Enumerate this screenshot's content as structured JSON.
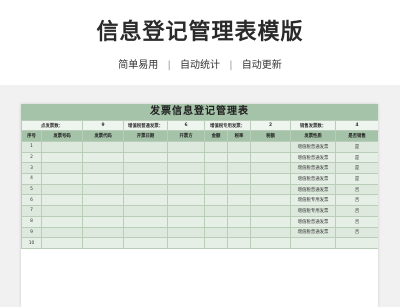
{
  "page": {
    "title": "信息登记管理表模版",
    "features": [
      "简单易用",
      "自动统计",
      "自动更新"
    ],
    "separator": "|"
  },
  "sheet": {
    "title": "发票信息登记管理表",
    "summary": [
      {
        "label": "点发票数：",
        "value": "9"
      },
      {
        "label": "增值税普通发票：",
        "value": "6"
      },
      {
        "label": "增值税专用发票：",
        "value": "2"
      },
      {
        "label": "销售发票数：",
        "value": "4"
      }
    ],
    "columns": [
      "序号",
      "发票号码",
      "发票代码",
      "开票日期",
      "开票方",
      "金额",
      "税率",
      "税额",
      "发票性质",
      "是否销售"
    ],
    "rows": [
      {
        "no": "1",
        "type": "增值税普通发票",
        "sale": "是"
      },
      {
        "no": "2",
        "type": "增值税普通发票",
        "sale": "是"
      },
      {
        "no": "3",
        "type": "增值税普通发票",
        "sale": "是"
      },
      {
        "no": "4",
        "type": "增值税普通发票",
        "sale": "是"
      },
      {
        "no": "5",
        "type": "增值税普通发票",
        "sale": "否"
      },
      {
        "no": "6",
        "type": "增值税专用发票",
        "sale": "否"
      },
      {
        "no": "7",
        "type": "增值税专用发票",
        "sale": "否"
      },
      {
        "no": "8",
        "type": "增值税普通发票",
        "sale": "否"
      },
      {
        "no": "9",
        "type": "增值税普通发票",
        "sale": "否"
      },
      {
        "no": "10",
        "type": "",
        "sale": ""
      }
    ]
  }
}
